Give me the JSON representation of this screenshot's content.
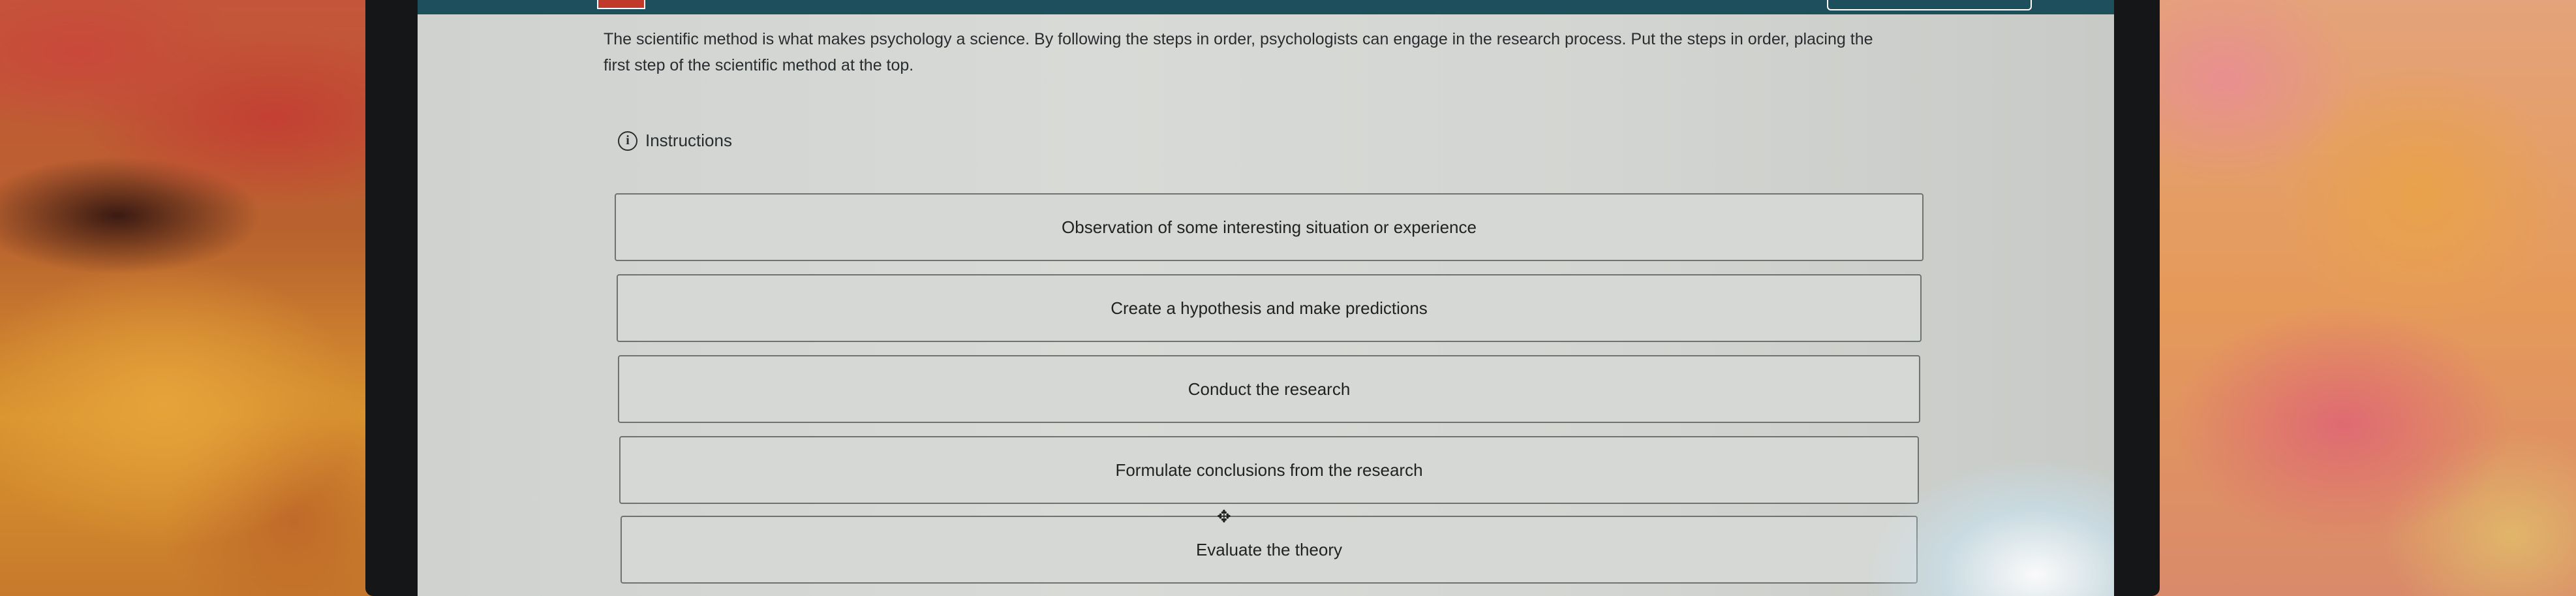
{
  "prompt": "The scientific method is what makes psychology a science. By following the steps in order, psychologists can engage in the research process. Put the steps in order, placing the first step of the scientific method at the top.",
  "instructions": {
    "label": "Instructions",
    "icon": "info-icon"
  },
  "steps": [
    "Observation of some interesting situation or experience",
    "Create a hypothesis and make predictions",
    "Conduct the research",
    "Formulate conclusions from the research",
    "Evaluate the theory"
  ],
  "colors": {
    "topbar": "#1d4f5c",
    "badge": "#c0392b",
    "screen": "#d2d4d2"
  }
}
